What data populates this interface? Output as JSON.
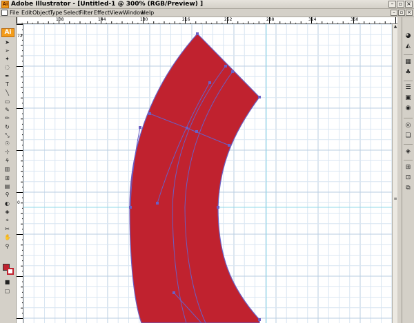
{
  "window": {
    "title": "Adobe Illustrator - [Untitled-1 @ 300% (RGB/Preview) ]",
    "app_badge": "Ai"
  },
  "menubar": {
    "items": [
      "File",
      "Edit",
      "Object",
      "Type",
      "Select",
      "Filter",
      "Effect",
      "View",
      "Window",
      "Help"
    ]
  },
  "ruler": {
    "top_labels": [
      "108",
      "144",
      "180",
      "216",
      "252",
      "288",
      "324",
      "360"
    ],
    "left_labels": [
      "0",
      "72"
    ]
  },
  "colors": {
    "shape_fill": "#c0222f",
    "path_stroke": "#6b5fc4",
    "guide": "#8fd8e8",
    "grid": "#d9e6f2",
    "grid_major": "#b9cde2"
  },
  "icons": {
    "tools": [
      "selection-tool-icon",
      "direct-selection-tool-icon",
      "magic-wand-icon",
      "lasso-icon",
      "pen-tool-icon",
      "type-tool-icon",
      "line-segment-icon",
      "rectangle-tool-icon",
      "paintbrush-icon",
      "pencil-icon",
      "rotate-tool-icon",
      "scale-tool-icon",
      "warp-tool-icon",
      "free-transform-icon",
      "symbol-sprayer-icon",
      "graph-tool-icon",
      "mesh-tool-icon",
      "gradient-tool-icon",
      "eyedropper-icon",
      "blend-tool-icon",
      "live-paint-icon",
      "slice-tool-icon",
      "scissors-icon",
      "hand-tool-icon",
      "zoom-tool-icon",
      "fill-stroke-icon",
      "screen-mode-icon"
    ],
    "panels": [
      "color-panel-icon",
      "swatches-panel-icon",
      "brushes-panel-icon",
      "symbols-panel-icon",
      "stroke-panel-icon",
      "gradient-panel-icon",
      "transparency-panel-icon",
      "appearance-panel-icon",
      "graphic-styles-panel-icon",
      "layers-panel-icon",
      "align-panel-icon",
      "transform-panel-icon",
      "pathfinder-panel-icon"
    ]
  }
}
